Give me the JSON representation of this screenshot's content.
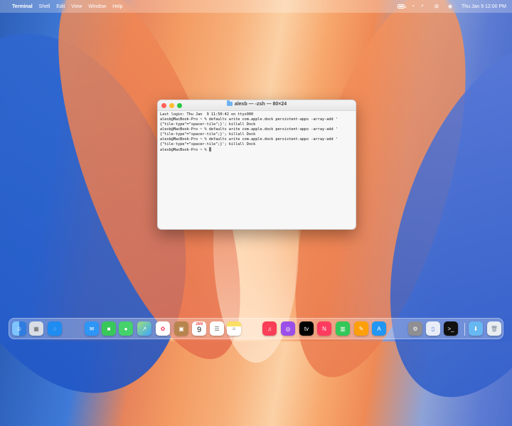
{
  "menu": {
    "app": "Terminal",
    "items": [
      "Shell",
      "Edit",
      "View",
      "Window",
      "Help"
    ],
    "clock": "Thu Jan 9  12:00 PM"
  },
  "terminal": {
    "title": "alexb — -zsh — 80×24",
    "lines": [
      "Last login: Thu Jan  9 11:50:42 on ttys000",
      "alexb@MacBook-Pro ~ % defaults write com.apple.dock persistent-apps -array-add '",
      "{\"tile-type\"=\"spacer-tile\";}'; killall Dock",
      "alexb@MacBook-Pro ~ % defaults write com.apple.dock persistent-apps -array-add '",
      "{\"tile-type\"=\"spacer-tile\";}'; killall Dock",
      "alexb@MacBook-Pro ~ % defaults write com.apple.dock persistent-apps -array-add '",
      "{\"tile-type\"=\"spacer-tile\";}'; killall Dock",
      "alexb@MacBook-Pro ~ % "
    ]
  },
  "dock": {
    "calendar_month": "JAN",
    "calendar_day": "9",
    "icons": [
      "finder-icon",
      "launchpad-icon",
      "safari-icon",
      "mail-icon",
      "facetime-icon",
      "messages-icon",
      "maps-icon",
      "photos-icon",
      "contacts-icon",
      "calendar-icon",
      "reminders-icon",
      "notes-icon",
      "music-icon",
      "podcasts-icon",
      "tv-icon",
      "news-icon",
      "numbers-icon",
      "pages-icon",
      "app-store-icon",
      "system-settings-icon",
      "iphone-mirroring-icon",
      "terminal-icon",
      "downloads-folder-icon",
      "trash-icon"
    ]
  },
  "colors": {
    "traffic_red": "#ff5f57",
    "traffic_yellow": "#ffbd2e",
    "traffic_green": "#28c840"
  }
}
